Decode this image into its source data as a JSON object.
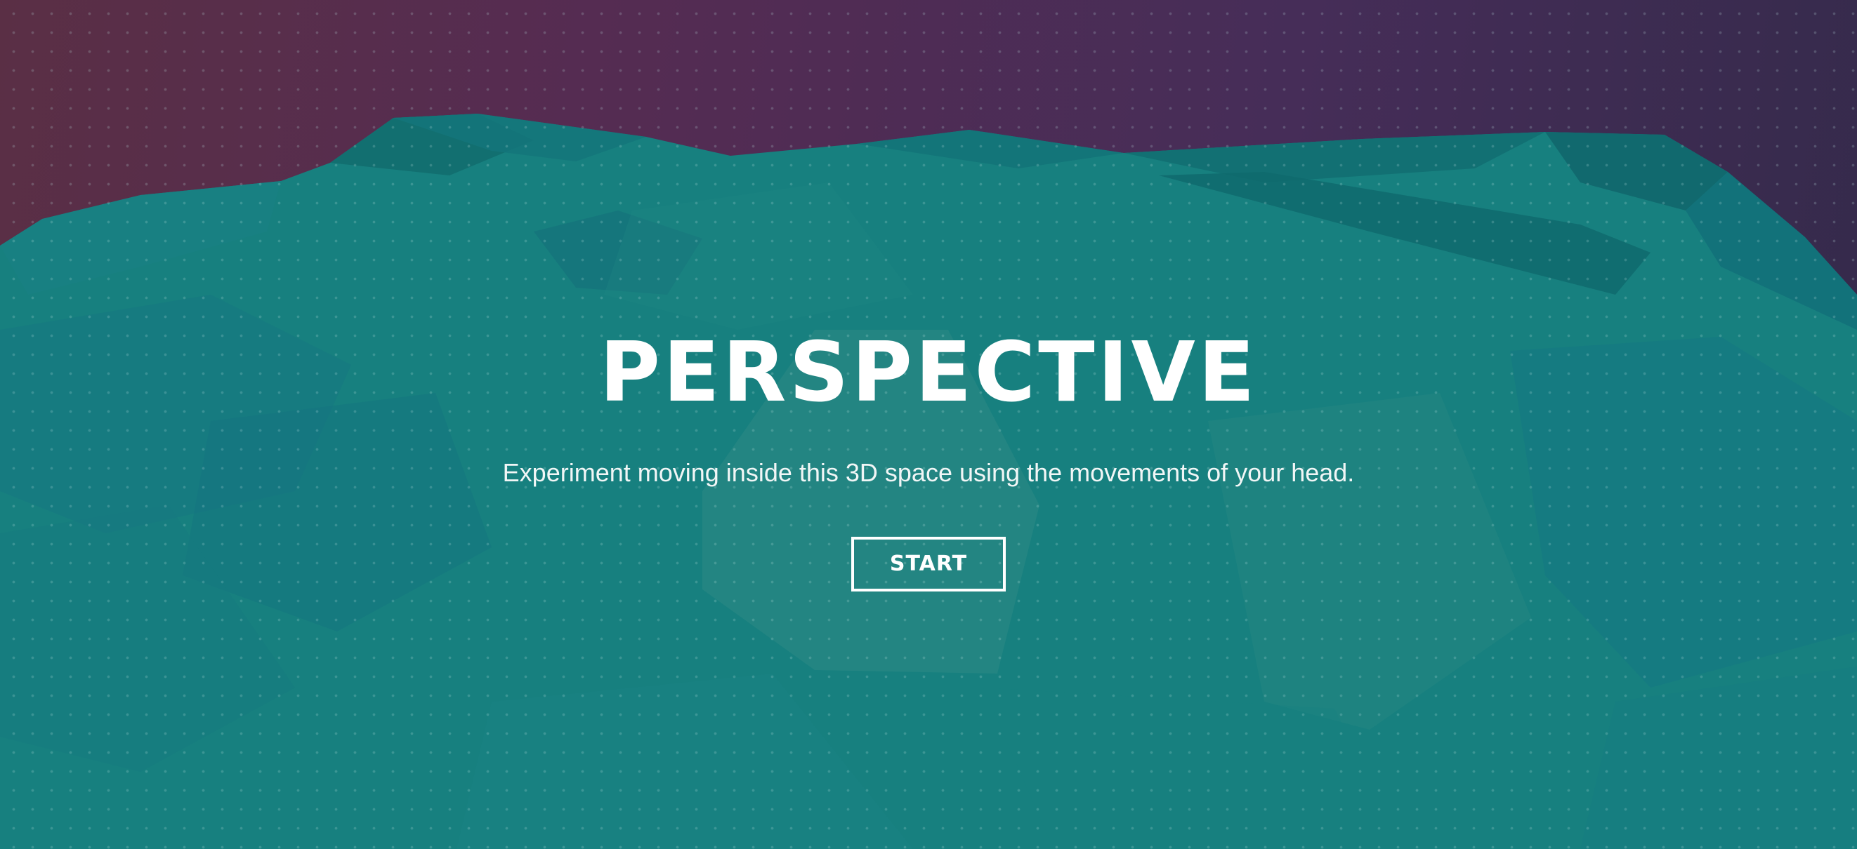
{
  "hero": {
    "title": "PERSPECTIVE",
    "subtitle": "Experiment moving inside this 3D space using the movements of your head.",
    "start_label": "START"
  },
  "colors": {
    "sky_left": "#5a2f45",
    "sky_right": "#332a4a",
    "terrain": "#17807f",
    "text": "#ffffff"
  }
}
